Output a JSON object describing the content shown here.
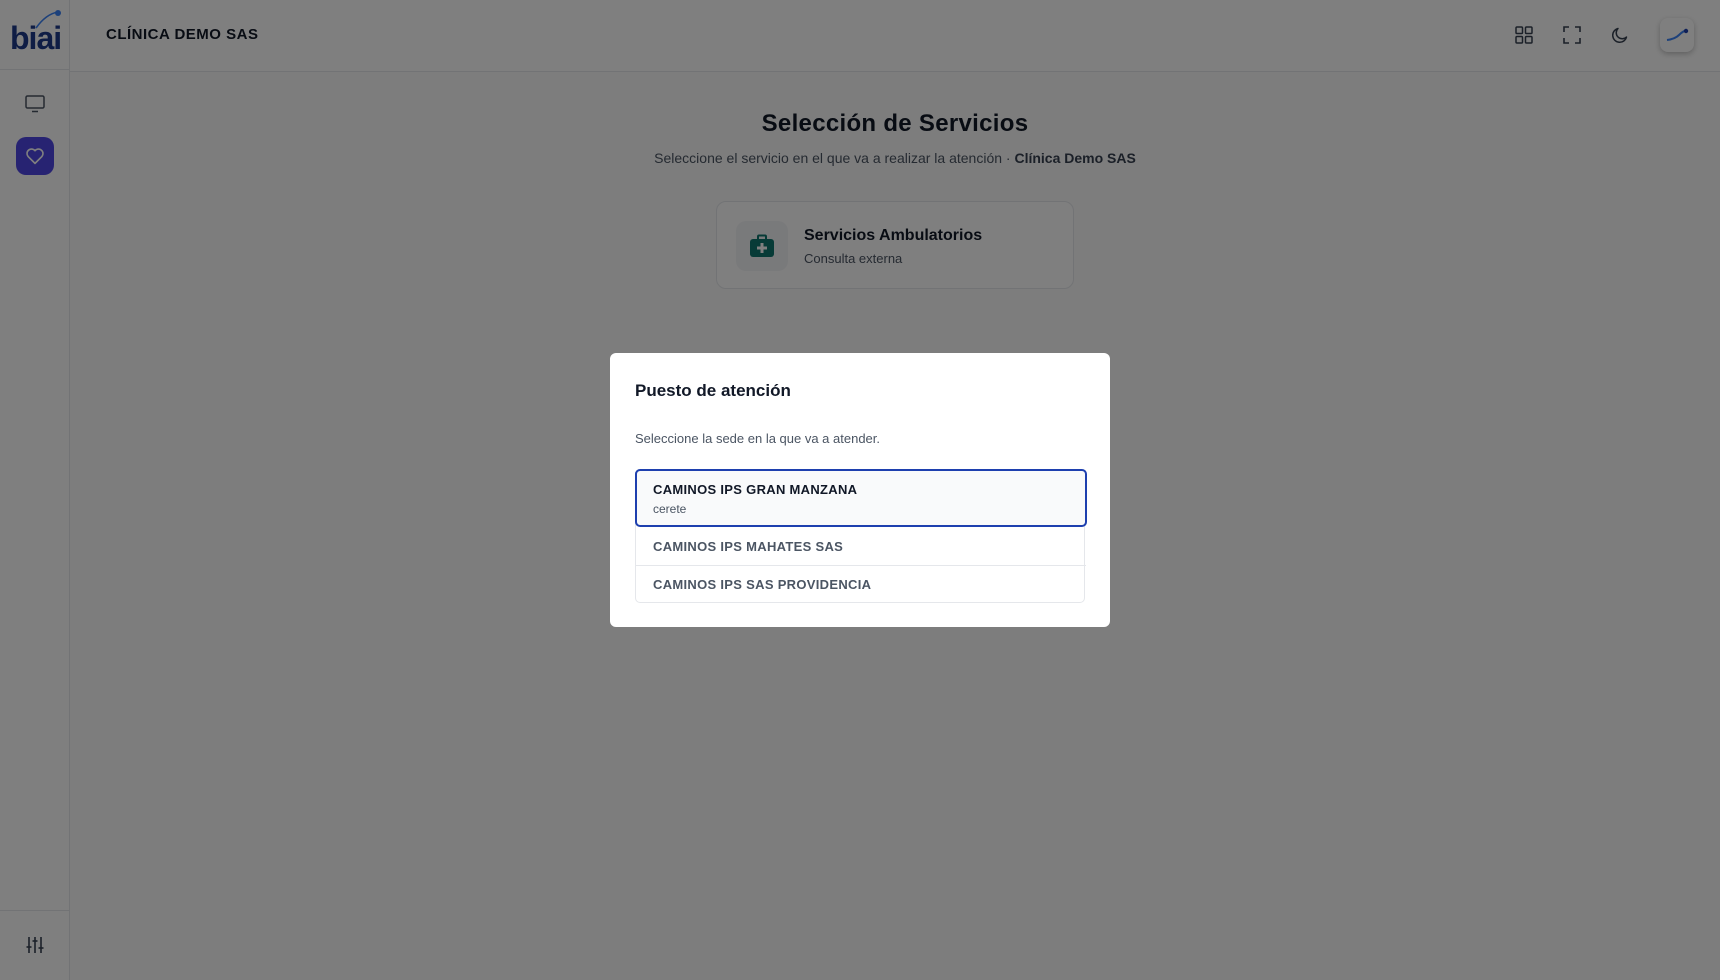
{
  "brand": {
    "logo_text": "biai"
  },
  "header": {
    "title": "CLÍNICA DEMO SAS"
  },
  "page": {
    "title": "Selección de Servicios",
    "subtitle": "Seleccione el servicio en el que va a realizar la atención ·",
    "subtitle_strong": "Clínica Demo SAS"
  },
  "service_card": {
    "name": "Servicios Ambulatorios",
    "description": "Consulta externa",
    "accent": "#0f766e"
  },
  "modal": {
    "title": "Puesto de atención",
    "description": "Seleccione la sede en la que va a atender.",
    "options": [
      {
        "name": "CAMINOS IPS GRAN MANZANA",
        "sub": "cerete",
        "selected": true
      },
      {
        "name": "CAMINOS IPS MAHATES SAS",
        "selected": false
      },
      {
        "name": "CAMINOS IPS SAS PROVIDENCIA",
        "selected": false
      }
    ]
  },
  "colors": {
    "sidebar_active": "#4f46e5",
    "selected_border": "#1e40af",
    "overlay": "rgba(0,0,0,0.5)"
  },
  "icons": {
    "sidebar": [
      "monitor-icon",
      "heart-icon",
      "sliders-icon"
    ],
    "header": [
      "grid-icon",
      "fullscreen-icon",
      "moon-icon"
    ],
    "service": "medical-kit-icon"
  }
}
